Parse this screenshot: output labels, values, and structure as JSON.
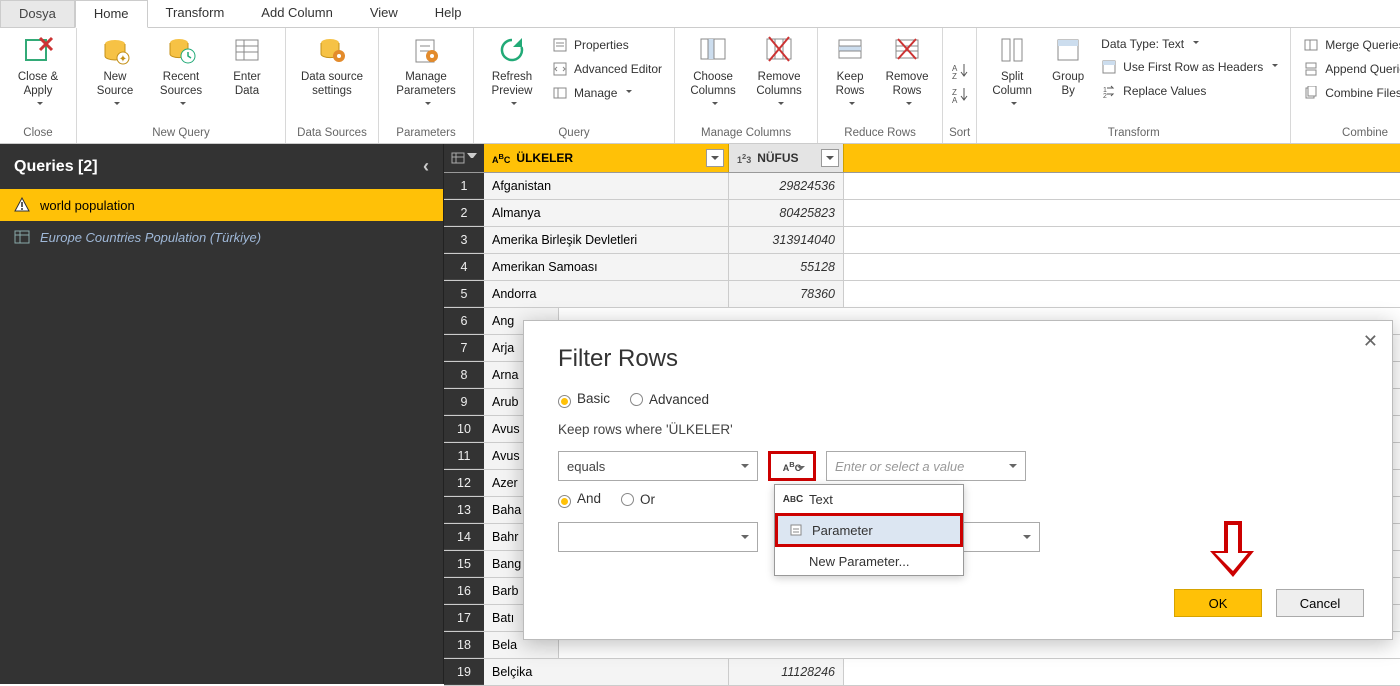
{
  "tabs": {
    "file": "Dosya",
    "home": "Home",
    "transform": "Transform",
    "addcol": "Add Column",
    "view": "View",
    "help": "Help"
  },
  "ribbon": {
    "close": {
      "closeApply": "Close &\nApply",
      "group": "Close"
    },
    "newquery": {
      "newSource": "New\nSource",
      "recentSources": "Recent\nSources",
      "enterData": "Enter\nData",
      "group": "New Query"
    },
    "datasources": {
      "settings": "Data source\nsettings",
      "group": "Data Sources"
    },
    "params": {
      "manage": "Manage\nParameters",
      "group": "Parameters"
    },
    "query": {
      "refresh": "Refresh\nPreview",
      "properties": "Properties",
      "advanced": "Advanced Editor",
      "manage": "Manage",
      "group": "Query"
    },
    "cols": {
      "choose": "Choose\nColumns",
      "remove": "Remove\nColumns",
      "group": "Manage Columns"
    },
    "rows": {
      "keep": "Keep\nRows",
      "remove": "Remove\nRows",
      "group": "Reduce Rows"
    },
    "sort": {
      "group": "Sort"
    },
    "transform": {
      "split": "Split\nColumn",
      "groupby": "Group\nBy",
      "dtype": "Data Type: Text",
      "firstrow": "Use First Row as Headers",
      "replace": "Replace Values",
      "group": "Transform"
    },
    "combine": {
      "merge": "Merge Queries",
      "append": "Append Queries",
      "files": "Combine Files",
      "group": "Combine"
    }
  },
  "sidebar": {
    "title": "Queries [2]",
    "items": [
      {
        "label": "world population"
      },
      {
        "label": "Europe Countries Population (Türkiye)"
      }
    ]
  },
  "grid": {
    "col1": "ÜLKELER",
    "col2": "NÜFUS",
    "rows": [
      {
        "n": "1",
        "a": "Afganistan",
        "b": "29824536"
      },
      {
        "n": "2",
        "a": "Almanya",
        "b": "80425823"
      },
      {
        "n": "3",
        "a": "Amerika Birleşik Devletleri",
        "b": "313914040"
      },
      {
        "n": "4",
        "a": "Amerikan Samoası",
        "b": "55128"
      },
      {
        "n": "5",
        "a": "Andorra",
        "b": "78360"
      },
      {
        "n": "6",
        "a": "Ang",
        "b": ""
      },
      {
        "n": "7",
        "a": "Arja",
        "b": ""
      },
      {
        "n": "8",
        "a": "Arna",
        "b": ""
      },
      {
        "n": "9",
        "a": "Arub",
        "b": ""
      },
      {
        "n": "10",
        "a": "Avus",
        "b": ""
      },
      {
        "n": "11",
        "a": "Avus",
        "b": ""
      },
      {
        "n": "12",
        "a": "Azer",
        "b": ""
      },
      {
        "n": "13",
        "a": "Baha",
        "b": ""
      },
      {
        "n": "14",
        "a": "Bahr",
        "b": ""
      },
      {
        "n": "15",
        "a": "Bang",
        "b": ""
      },
      {
        "n": "16",
        "a": "Barb",
        "b": ""
      },
      {
        "n": "17",
        "a": "Batı",
        "b": ""
      },
      {
        "n": "18",
        "a": "Bela",
        "b": ""
      },
      {
        "n": "19",
        "a": "Belçika",
        "b": "11128246"
      }
    ]
  },
  "dialog": {
    "title": "Filter Rows",
    "basic": "Basic",
    "advanced": "Advanced",
    "keep": "Keep rows where 'ÜLKELER'",
    "op1": "equals",
    "valPlaceholder": "Enter or select a value",
    "and": "And",
    "or": "Or",
    "menu": {
      "text": "Text",
      "param": "Parameter",
      "newparam": "New Parameter..."
    },
    "ok": "OK",
    "cancel": "Cancel"
  }
}
